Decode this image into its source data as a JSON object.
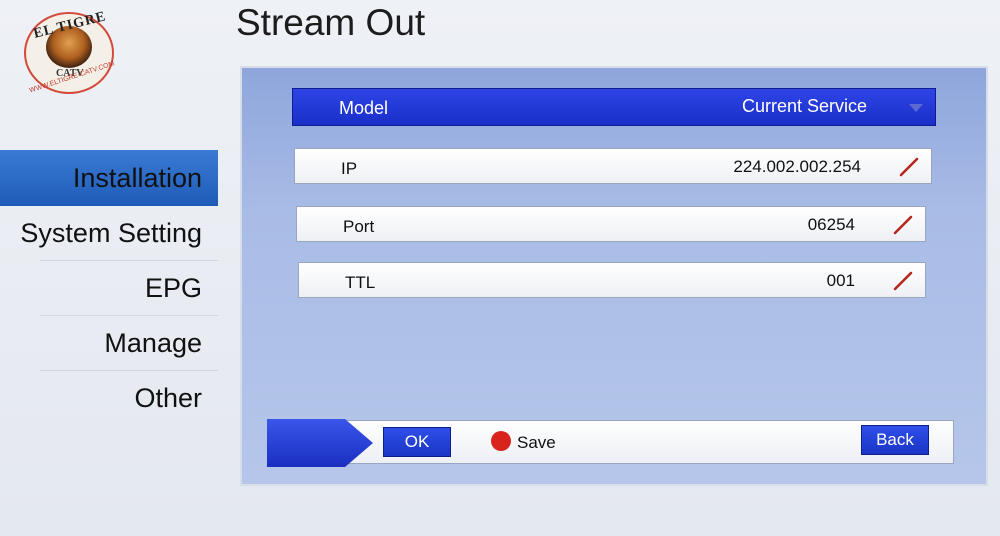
{
  "logo": {
    "brand": "EL TIGRE",
    "sub": "CATV",
    "url": "WWW.ELTIGRE-CATV.COM"
  },
  "page_title": "Stream Out",
  "sidebar": {
    "items": [
      {
        "label": "Installation",
        "active": true
      },
      {
        "label": "System Setting",
        "active": false
      },
      {
        "label": "EPG",
        "active": false
      },
      {
        "label": "Manage",
        "active": false
      },
      {
        "label": "Other",
        "active": false
      }
    ]
  },
  "model": {
    "label": "Model",
    "value": "Current Service",
    "icon": "dropdown-arrow-icon"
  },
  "fields": [
    {
      "label": "IP",
      "value": "224.002.002.254",
      "icon": "pencil-icon"
    },
    {
      "label": "Port",
      "value": "06254",
      "icon": "pencil-icon"
    },
    {
      "label": "TTL",
      "value": "001",
      "icon": "pencil-icon"
    }
  ],
  "footer": {
    "ok": "OK",
    "save": "Save",
    "back": "Back"
  },
  "colors": {
    "accent": "#1a2fc8",
    "save_dot": "#d8241c",
    "active_sidebar": "#2a6ac8"
  }
}
